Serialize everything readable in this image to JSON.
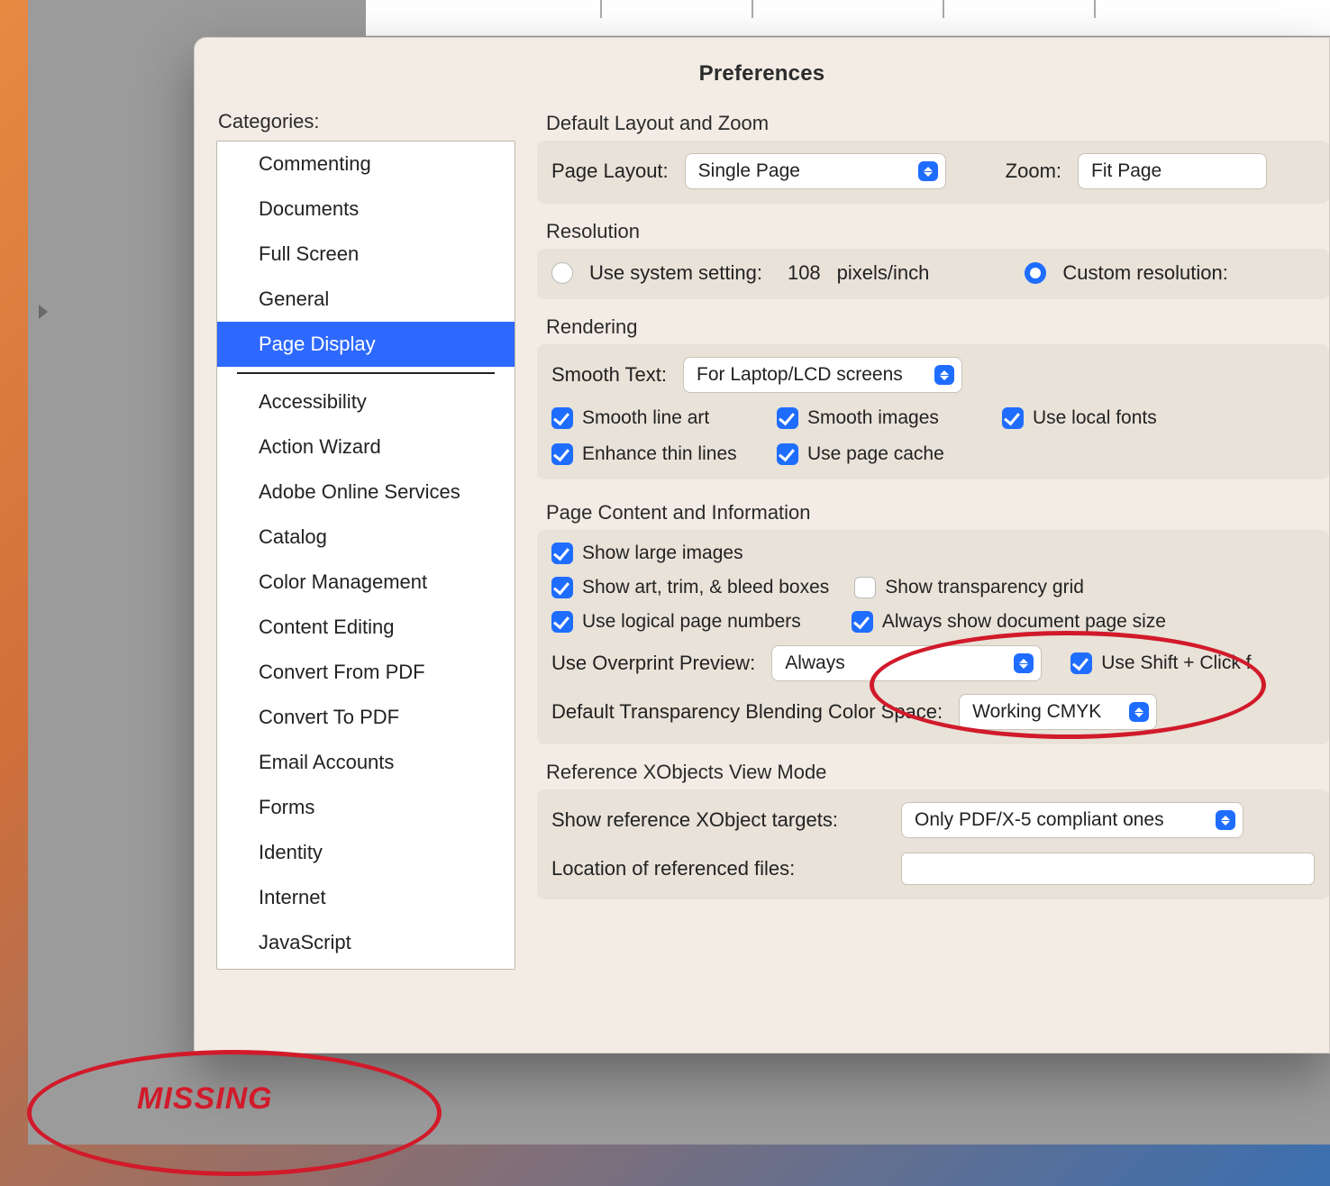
{
  "window_title": "Preferences",
  "sidebar": {
    "label": "Categories:",
    "items_top": [
      "Commenting",
      "Documents",
      "Full Screen",
      "General",
      "Page Display"
    ],
    "selected_index": 4,
    "items_bottom": [
      "Accessibility",
      "Action Wizard",
      "Adobe Online Services",
      "Catalog",
      "Color Management",
      "Content Editing",
      "Convert From PDF",
      "Convert To PDF",
      "Email Accounts",
      "Forms",
      "Identity",
      "Internet",
      "JavaScript"
    ]
  },
  "layout_zoom": {
    "title": "Default Layout and Zoom",
    "page_layout_label": "Page Layout:",
    "page_layout_value": "Single Page",
    "zoom_label": "Zoom:",
    "zoom_value": "Fit Page"
  },
  "resolution": {
    "title": "Resolution",
    "system_label": "Use system setting:",
    "system_value": "108",
    "system_units": "pixels/inch",
    "custom_label": "Custom resolution:"
  },
  "rendering": {
    "title": "Rendering",
    "smooth_text_label": "Smooth Text:",
    "smooth_text_value": "For Laptop/LCD screens",
    "smooth_line_art": "Smooth line art",
    "smooth_images": "Smooth images",
    "use_local_fonts": "Use local fonts",
    "enhance_thin_lines": "Enhance thin lines",
    "use_page_cache": "Use page cache"
  },
  "page_content": {
    "title": "Page Content and Information",
    "show_large_images": "Show large images",
    "show_boxes": "Show art, trim, & bleed boxes",
    "show_transparency_grid": "Show transparency grid",
    "use_logical_page_numbers": "Use logical page numbers",
    "always_show_page_size": "Always show document page size",
    "overprint_label": "Use Overprint Preview:",
    "overprint_value": "Always",
    "shift_click": "Use Shift + Click f",
    "blend_label": "Default Transparency Blending Color Space:",
    "blend_value": "Working CMYK"
  },
  "xobjects": {
    "title": "Reference XObjects View Mode",
    "show_targets_label": "Show reference XObject targets:",
    "show_targets_value": "Only PDF/X-5 compliant ones",
    "location_label": "Location of referenced files:"
  },
  "annotation": {
    "missing": "MISSING"
  }
}
